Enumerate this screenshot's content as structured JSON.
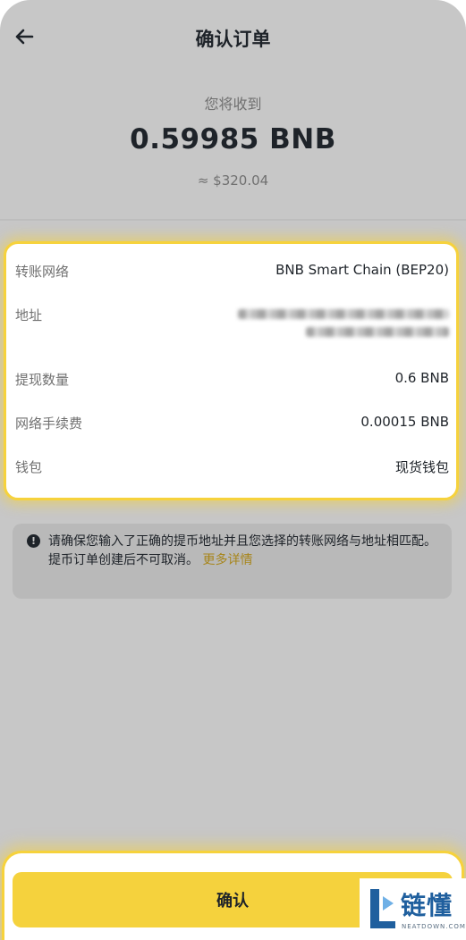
{
  "header": {
    "title": "确认订单"
  },
  "summary": {
    "receive_label": "您将收到",
    "amount": "0.59985 BNB",
    "fiat": "≈ $320.04"
  },
  "details": {
    "network_label": "转账网络",
    "network_value": "BNB Smart Chain (BEP20)",
    "address_label": "地址",
    "amount_label": "提现数量",
    "amount_value": "0.6 BNB",
    "fee_label": "网络手续费",
    "fee_value": "0.00015 BNB",
    "wallet_label": "钱包",
    "wallet_value": "现货钱包"
  },
  "notice": {
    "line1": "请确保您输入了正确的提币地址并且您选择的转账网络与地址相匹配。",
    "line2": "提币订单创建后不可取消。",
    "link": "更多详情"
  },
  "footer": {
    "confirm_label": "确认"
  },
  "watermark": {
    "text": "链懂",
    "sub": "NEATDOWN.COM"
  },
  "colors": {
    "accent": "#f5d23d",
    "highlight": "#f6d23c",
    "link": "#a7851a"
  }
}
